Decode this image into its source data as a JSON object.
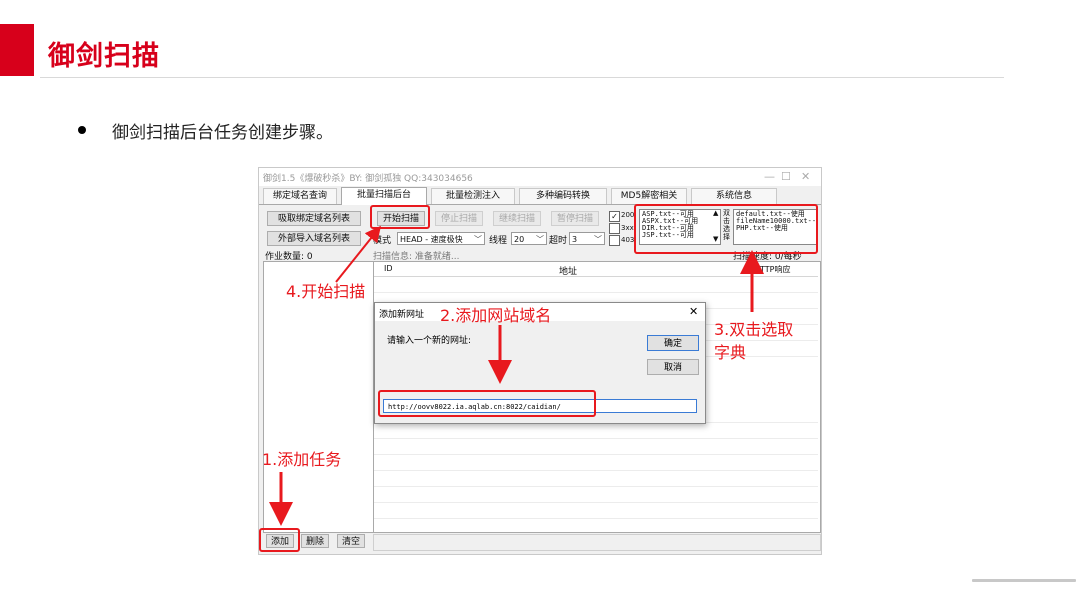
{
  "slide": {
    "title": "御剑扫描",
    "bullet": "御剑扫描后台任务创建步骤。"
  },
  "window": {
    "title": "御剑1.5《爆破秒杀》BY: 御剑孤独 QQ:343034656",
    "controls": [
      "—",
      "☐",
      "✕"
    ],
    "tabs": [
      {
        "label": "绑定域名查询",
        "active": false
      },
      {
        "label": "批量扫描后台",
        "active": true
      },
      {
        "label": "批量检测注入",
        "active": false
      },
      {
        "label": "多种编码转换",
        "active": false
      },
      {
        "label": "MD5解密相关",
        "active": false
      },
      {
        "label": "系统信息",
        "active": false
      }
    ]
  },
  "toolbar": {
    "btn_import_bound": "吸取绑定域名列表",
    "btn_import_external": "外部导入域名列表",
    "btn_start": "开始扫描",
    "btn_stop": "停止扫描",
    "btn_continue": "继续扫描",
    "btn_pause": "暂停扫描",
    "mode_label": "模式",
    "mode_value": "HEAD - 速度极快",
    "threads_label": "线程",
    "threads_value": "20",
    "timeout_label": "超时",
    "timeout_value": "3",
    "task_count": "作业数量: 0",
    "scan_info": "扫描信息: 准备就绪...",
    "scan_speed": "扫描速度: 0/每秒"
  },
  "status_filters": [
    {
      "label": "200",
      "checked": true
    },
    {
      "label": "3xx",
      "checked": false
    },
    {
      "label": "403",
      "checked": false
    }
  ],
  "dict_list_1": [
    "ASP.txt--可用",
    "ASPX.txt--可用",
    "DIR.txt--可用",
    "JSP.txt--可用"
  ],
  "dict_list_2_label": "双击选择",
  "dict_list_2": [
    "default.txt--使用",
    "fileName10000.txt--",
    "PHP.txt--使用"
  ],
  "grid": {
    "col_id": "ID",
    "col_url": "地址",
    "col_http": "HTTP响应"
  },
  "bottom_buttons": {
    "add": "添加",
    "delete": "删除",
    "clear": "清空"
  },
  "dialog": {
    "title": "添加新网址",
    "prompt": "请输入一个新的网址:",
    "ok": "确定",
    "cancel": "取消",
    "close": "✕",
    "input_value": "http://oovv8022.ia.aqlab.cn:8022/caidian/"
  },
  "annotations": {
    "step1": "1.添加任务",
    "step2": "2.添加网站域名",
    "step3_line1": "3.双击选取",
    "step3_line2": "字典",
    "step4": "4.开始扫描"
  },
  "colors": {
    "accent": "#d7001b",
    "annotation": "#e8191e"
  }
}
